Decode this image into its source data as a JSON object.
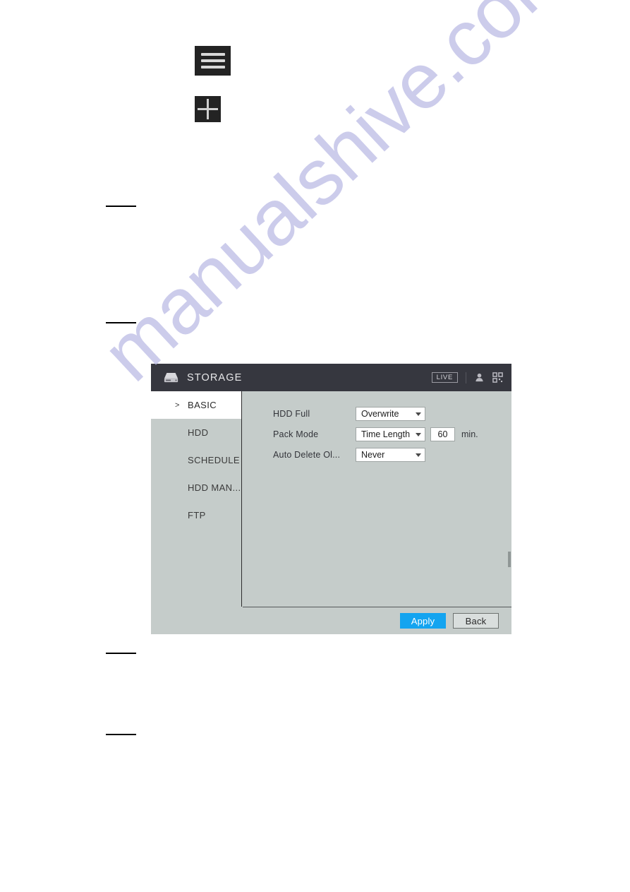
{
  "page": {
    "watermark": "manualshive.com",
    "icon_tiles": [
      {
        "name": "hamburger-menu-icon",
        "glyph": "menu"
      },
      {
        "name": "quad-split-icon",
        "glyph": "plus"
      }
    ],
    "margin_rules": [
      291,
      456,
      924,
      1039
    ]
  },
  "dialog": {
    "header": {
      "title": "STORAGE",
      "storage_icon": "hdd-icon",
      "live_badge": "LIVE",
      "user_icon": "user-icon",
      "grid_icon": "grid-matrix-icon"
    },
    "sidebar": {
      "items": [
        {
          "label": "BASIC",
          "active": true,
          "chevron": ">"
        },
        {
          "label": "HDD",
          "active": false,
          "chevron": ""
        },
        {
          "label": "SCHEDULE",
          "active": false,
          "chevron": ""
        },
        {
          "label": "HDD MAN...",
          "active": false,
          "chevron": ""
        },
        {
          "label": "FTP",
          "active": false,
          "chevron": ""
        }
      ]
    },
    "form": {
      "hdd_full": {
        "label": "HDD Full",
        "value": "Overwrite"
      },
      "pack_mode": {
        "label": "Pack Mode",
        "value": "Time Length",
        "duration": "60",
        "unit": "min."
      },
      "auto_delete": {
        "label": "Auto Delete Ol...",
        "value": "Never"
      }
    },
    "footer": {
      "apply_label": "Apply",
      "back_label": "Back"
    },
    "colors": {
      "header_bg": "#36373f",
      "content_bg": "#c5ccca",
      "apply_blue": "#14a4f0",
      "watermark": "#b9b9e4"
    }
  }
}
